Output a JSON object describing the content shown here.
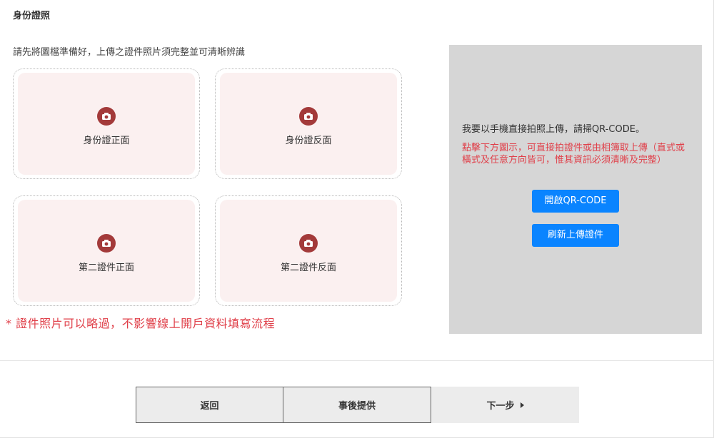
{
  "section": {
    "title": "身份證照"
  },
  "upload": {
    "instruction": "請先將圖檔準備好，上傳之證件照片須完整並可清晰辨識",
    "slots": [
      {
        "label": "身份證正面",
        "icon": "camera-icon"
      },
      {
        "label": "身份證反面",
        "icon": "camera-icon"
      },
      {
        "label": "第二證件正面",
        "icon": "camera-icon"
      },
      {
        "label": "第二證件反面",
        "icon": "camera-icon"
      }
    ],
    "note": "* 證件照片可以略過，不影響線上開戶資料填寫流程"
  },
  "qr_panel": {
    "text1": "我要以手機直接拍照上傳，請掃QR-CODE。",
    "text2": "點擊下方圖示，可直接拍證件或由相簿取上傳（直式或橫式及任意方向皆可，惟其資訊必須清晰及完整）",
    "open_button": "開啟QR-CODE",
    "refresh_button": "刷新上傳證件"
  },
  "footer": {
    "back": "返回",
    "later": "事後提供",
    "next": "下一步"
  },
  "colors": {
    "accent_red": "#e0404a",
    "button_blue": "#0a84ff",
    "camera_badge": "#a33a3a",
    "panel_gray": "#d6d6d6"
  }
}
